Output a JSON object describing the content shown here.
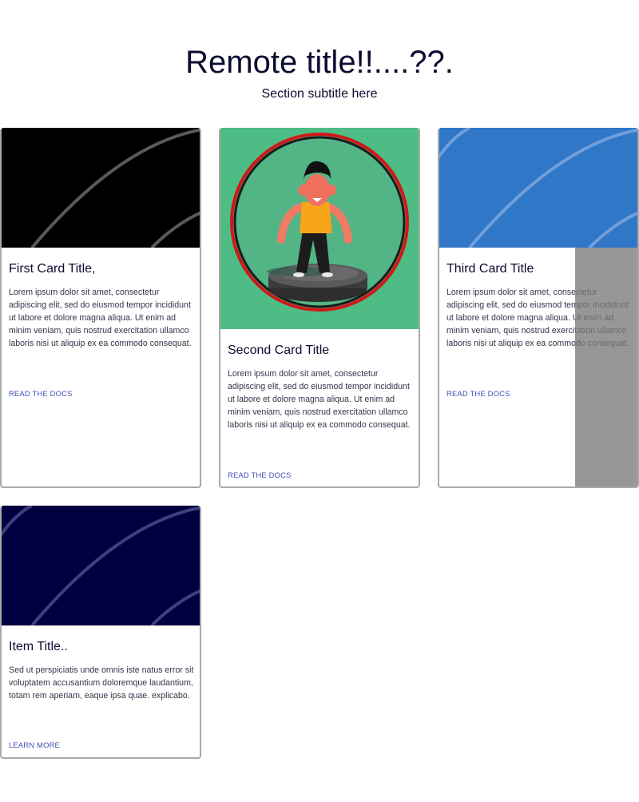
{
  "section": {
    "title": "Remote title!!....??.",
    "subtitle": "Section subtitle here"
  },
  "colors": {
    "card1_media": "#000000",
    "card2_media": "#4dbd85",
    "card3_media": "#3177c7",
    "card4_media": "#000040",
    "link": "#3f4fb8",
    "overlay": "#969696"
  },
  "cards": [
    {
      "title": "First Card Title,",
      "text": "Lorem ipsum dolor sit amet, consectetur adipiscing elit, sed do eiusmod tempor incididunt ut labore et dolore magna aliqua. Ut enim ad minim veniam, quis nostrud exercitation ullamco laboris nisi ut aliquip ex ea commodo consequat.",
      "link": "READ THE DOCS",
      "media": "black-arc-pattern"
    },
    {
      "title": "Second Card Title",
      "text": "Lorem ipsum dolor sit amet, consectetur adipiscing elit, sed do eiusmod tempor incididunt ut labore et dolore magna aliqua. Ut enim ad minim veniam, quis nostrud exercitation ullamco laboris nisi ut aliquip ex ea commodo consequat.",
      "link": "READ THE DOCS",
      "media": "cartoon-character-illustration"
    },
    {
      "title": "Third Card Title",
      "text": "Lorem ipsum dolor sit amet, consectetur adipiscing elit, sed do eiusmod tempor incididunt ut labore et dolore magna aliqua. Ut enim ad minim veniam, quis nostrud exercitation ullamco laboris nisi ut aliquip ex ea commodo consequat.",
      "link": "READ THE DOCS",
      "media": "blue-arc-pattern"
    },
    {
      "title": "Item Title..",
      "text": "Sed ut perspiciatis unde omnis iste natus error sit voluptatem accusantium doloremque laudantium, totam rem aperiam, eaque ipsa quae. explicabo.",
      "link": "LEARN MORE",
      "media": "navy-arc-pattern"
    }
  ]
}
